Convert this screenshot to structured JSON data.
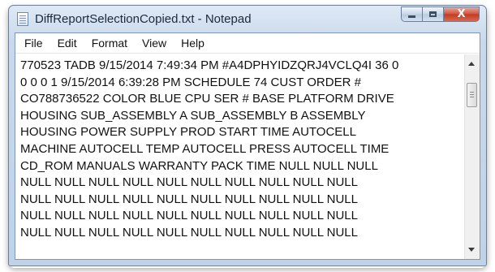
{
  "window": {
    "title": "DiffReportSelectionCopied.txt - Notepad",
    "close_glyph": "X"
  },
  "menu": {
    "file": "File",
    "edit": "Edit",
    "format": "Format",
    "view": "View",
    "help": "Help"
  },
  "editor": {
    "lines": [
      "770523 TADB 9/15/2014 7:49:34 PM #A4DPHYIDZQRJ4VCLQ4I 36 0",
      "0  0 0 1  9/15/2014 6:39:28 PM SCHEDULE 74 CUST ORDER #",
      "CO788736522 COLOR BLUE CPU SER #  BASE PLATFORM  DRIVE",
      "HOUSING  SUB_ASSEMBLY A  SUB_ASSEMBLY B  ASSEMBLY",
      "HOUSING  POWER SUPPLY  PROD START TIME  AUTOCELL",
      "MACHINE  AUTOCELL TEMP  AUTOCELL PRESS  AUTOCELL TIME",
      "CD_ROM  MANUALS  WARRANTY  PACK TIME  NULL NULL NULL",
      "NULL NULL NULL NULL NULL NULL NULL NULL NULL NULL",
      "NULL NULL NULL NULL NULL NULL NULL NULL NULL NULL",
      "NULL NULL NULL NULL NULL NULL NULL NULL NULL NULL",
      "NULL NULL NULL NULL NULL NULL NULL NULL NULL NULL"
    ]
  }
}
